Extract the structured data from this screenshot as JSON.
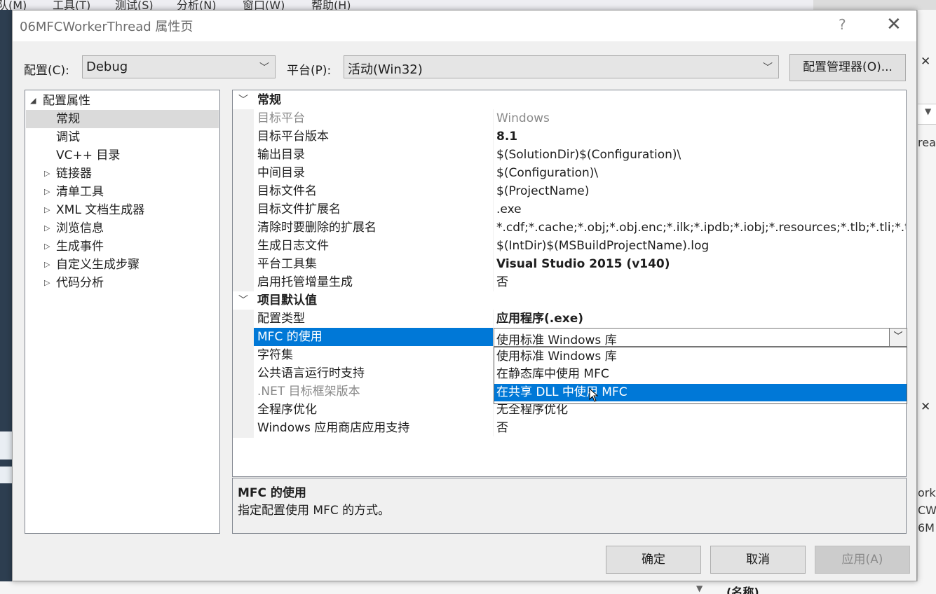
{
  "ide": {
    "menu": [
      "队(M)",
      "工具(T)",
      "测试(S)",
      "分析(N)",
      "窗口(W)",
      "帮助(H)"
    ],
    "right_fragments": [
      "rea",
      "ork",
      "CW",
      "6M"
    ],
    "bottom_text": "(名称)"
  },
  "dialog": {
    "title": "06MFCWorkerThread 属性页",
    "help_label": "?",
    "close_label": "✕",
    "config_label": "配置(C):",
    "config_value": "Debug",
    "platform_label": "平台(P):",
    "platform_value": "活动(Win32)",
    "config_manager_label": "配置管理器(O)...",
    "ok_label": "确定",
    "cancel_label": "取消",
    "apply_label": "应用(A)"
  },
  "tree": {
    "root": "配置属性",
    "items": [
      {
        "label": "常规",
        "selected": true,
        "expandable": false
      },
      {
        "label": "调试",
        "selected": false,
        "expandable": false
      },
      {
        "label": "VC++ 目录",
        "selected": false,
        "expandable": false
      },
      {
        "label": "链接器",
        "selected": false,
        "expandable": true
      },
      {
        "label": "清单工具",
        "selected": false,
        "expandable": true
      },
      {
        "label": "XML 文档生成器",
        "selected": false,
        "expandable": true
      },
      {
        "label": "浏览信息",
        "selected": false,
        "expandable": true
      },
      {
        "label": "生成事件",
        "selected": false,
        "expandable": true
      },
      {
        "label": "自定义生成步骤",
        "selected": false,
        "expandable": true
      },
      {
        "label": "代码分析",
        "selected": false,
        "expandable": true
      }
    ]
  },
  "grid": {
    "cat1": "常规",
    "general": [
      {
        "key": "目标平台",
        "value": "Windows",
        "gray": true,
        "bold": false
      },
      {
        "key": "目标平台版本",
        "value": "8.1",
        "gray": false,
        "bold": true
      },
      {
        "key": "输出目录",
        "value": "$(SolutionDir)$(Configuration)\\",
        "gray": false,
        "bold": false
      },
      {
        "key": "中间目录",
        "value": "$(Configuration)\\",
        "gray": false,
        "bold": false
      },
      {
        "key": "目标文件名",
        "value": "$(ProjectName)",
        "gray": false,
        "bold": false
      },
      {
        "key": "目标文件扩展名",
        "value": ".exe",
        "gray": false,
        "bold": false
      },
      {
        "key": "清除时要删除的扩展名",
        "value": "*.cdf;*.cache;*.obj;*.obj.enc;*.ilk;*.ipdb;*.iobj;*.resources;*.tlb;*.tli;*.tlh;*",
        "gray": false,
        "bold": false
      },
      {
        "key": "生成日志文件",
        "value": "$(IntDir)$(MSBuildProjectName).log",
        "gray": false,
        "bold": false
      },
      {
        "key": "平台工具集",
        "value": "Visual Studio 2015 (v140)",
        "gray": false,
        "bold": true
      },
      {
        "key": "启用托管增量生成",
        "value": "否",
        "gray": false,
        "bold": false
      }
    ],
    "cat2": "项目默认值",
    "defaults": [
      {
        "key": "配置类型",
        "value": "应用程序(.exe)",
        "gray": false,
        "bold": true
      },
      {
        "key": "MFC 的使用",
        "value": "",
        "gray": false,
        "bold": false
      },
      {
        "key": "字符集",
        "value": "",
        "gray": false,
        "bold": false
      },
      {
        "key": "公共语言运行时支持",
        "value": "",
        "gray": false,
        "bold": false
      },
      {
        "key": ".NET 目标框架版本",
        "value": "",
        "gray": true,
        "bold": false
      },
      {
        "key": "全程序优化",
        "value": "无全程序优化",
        "gray": false,
        "bold": false
      },
      {
        "key": "Windows 应用商店应用支持",
        "value": "否",
        "gray": false,
        "bold": false
      }
    ],
    "mfc_current": "使用标准 Windows 库",
    "mfc_options": [
      "使用标准 Windows 库",
      "在静态库中使用 MFC",
      "在共享 DLL 中使用 MFC"
    ],
    "mfc_highlighted_index": 2
  },
  "description": {
    "title": "MFC 的使用",
    "text": "指定配置使用 MFC 的方式。"
  },
  "colors": {
    "selection": "#0078d7",
    "tree_selection": "#dadada"
  }
}
